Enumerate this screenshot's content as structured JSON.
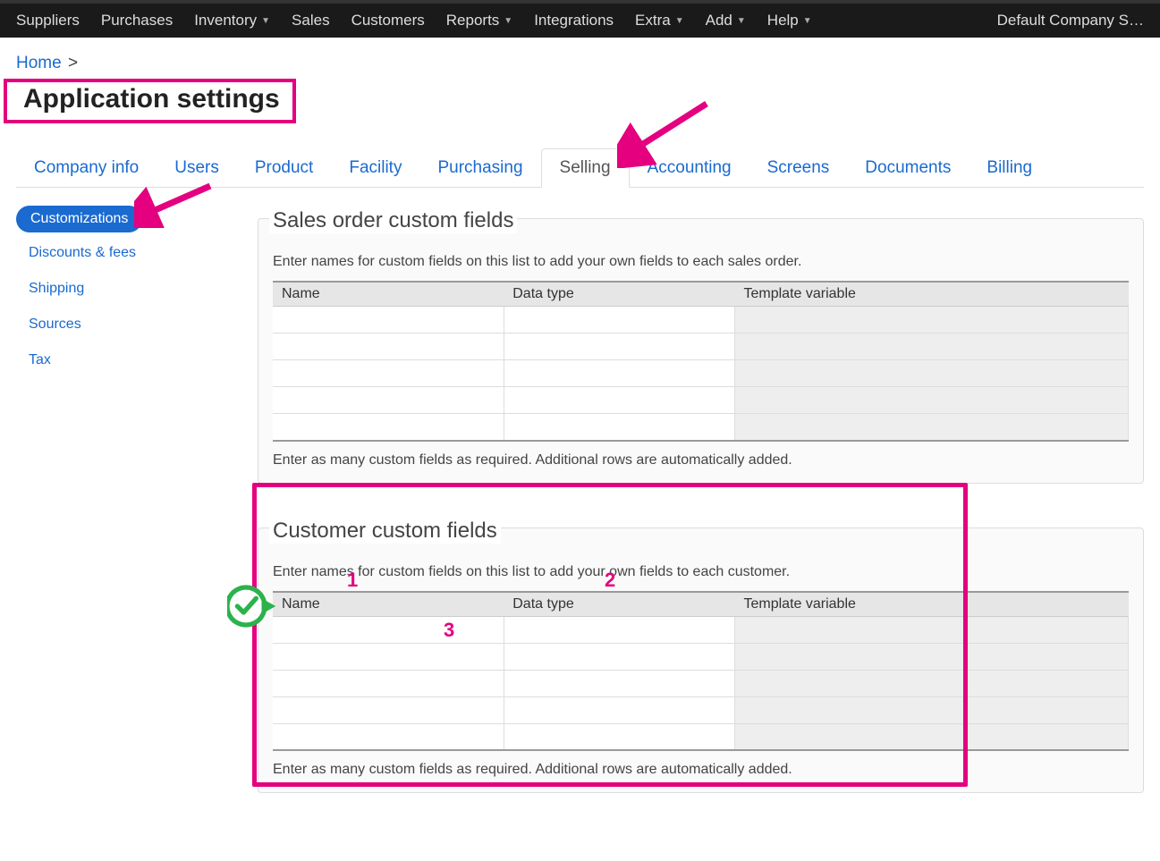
{
  "topnav": {
    "items": [
      {
        "label": "Suppliers",
        "caret": false
      },
      {
        "label": "Purchases",
        "caret": false
      },
      {
        "label": "Inventory",
        "caret": true
      },
      {
        "label": "Sales",
        "caret": false
      },
      {
        "label": "Customers",
        "caret": false
      },
      {
        "label": "Reports",
        "caret": true
      },
      {
        "label": "Integrations",
        "caret": false
      },
      {
        "label": "Extra",
        "caret": true
      },
      {
        "label": "Add",
        "caret": true
      },
      {
        "label": "Help",
        "caret": true
      }
    ],
    "company_label": "Default Company S…"
  },
  "breadcrumb": {
    "home": "Home",
    "sep": ">"
  },
  "page_title": "Application settings",
  "tabs": [
    {
      "label": "Company info",
      "active": false
    },
    {
      "label": "Users",
      "active": false
    },
    {
      "label": "Product",
      "active": false
    },
    {
      "label": "Facility",
      "active": false
    },
    {
      "label": "Purchasing",
      "active": false
    },
    {
      "label": "Selling",
      "active": true
    },
    {
      "label": "Accounting",
      "active": false
    },
    {
      "label": "Screens",
      "active": false
    },
    {
      "label": "Documents",
      "active": false
    },
    {
      "label": "Billing",
      "active": false
    }
  ],
  "sidebar": {
    "items": [
      {
        "label": "Customizations",
        "active": true
      },
      {
        "label": "Discounts & fees",
        "active": false
      },
      {
        "label": "Shipping",
        "active": false
      },
      {
        "label": "Sources",
        "active": false
      },
      {
        "label": "Tax",
        "active": false
      }
    ]
  },
  "groups": {
    "sales_order": {
      "legend": "Sales order custom fields",
      "desc": "Enter names for custom fields on this list to add your own fields to each sales order.",
      "columns": [
        "Name",
        "Data type",
        "Template variable"
      ],
      "rows": 5,
      "foot": "Enter as many custom fields as required. Additional rows are automatically added."
    },
    "customer": {
      "legend": "Customer custom fields",
      "desc": "Enter names for custom fields on this list to add your own fields to each customer.",
      "columns": [
        "Name",
        "Data type",
        "Template variable"
      ],
      "rows": 5,
      "foot": "Enter as many custom fields as required. Additional rows are automatically added."
    }
  },
  "annotations": {
    "numbers": [
      "1",
      "2",
      "3"
    ],
    "colors": {
      "accent": "#e4007f",
      "check_green": "#2bb24c"
    }
  }
}
